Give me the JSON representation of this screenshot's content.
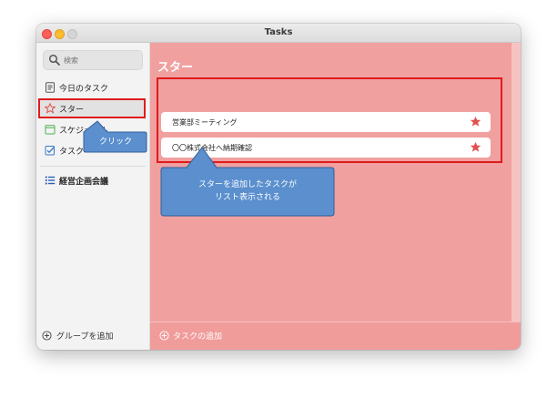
{
  "window": {
    "title": "Tasks"
  },
  "sidebar": {
    "search_placeholder": "検索",
    "items": [
      {
        "label": "今日のタスク",
        "icon": "today-list-icon"
      },
      {
        "label": "スター",
        "icon": "star-outline-icon"
      },
      {
        "label": "スケジュール",
        "icon": "calendar-icon"
      },
      {
        "label": "タスク",
        "icon": "checkbox-icon"
      }
    ],
    "groups": [
      {
        "label": "経営企画会議",
        "icon": "list-icon"
      }
    ],
    "add_group_label": "グループを追加"
  },
  "main": {
    "title": "スター",
    "tasks": [
      {
        "title": "営業部ミーティング",
        "starred": true
      },
      {
        "title": "〇〇株式会社へ納期確認",
        "starred": true
      }
    ],
    "add_task_label": "タスクの追加"
  },
  "annotations": {
    "click_label": "クリック",
    "note_line1": "スターを追加したタスクが",
    "note_line2": "リスト表示される"
  },
  "colors": {
    "accent_bg": "#f0a09f",
    "highlight_red": "#e01b1b",
    "star_red": "#e0524f",
    "callout_blue": "#5b8fce"
  }
}
